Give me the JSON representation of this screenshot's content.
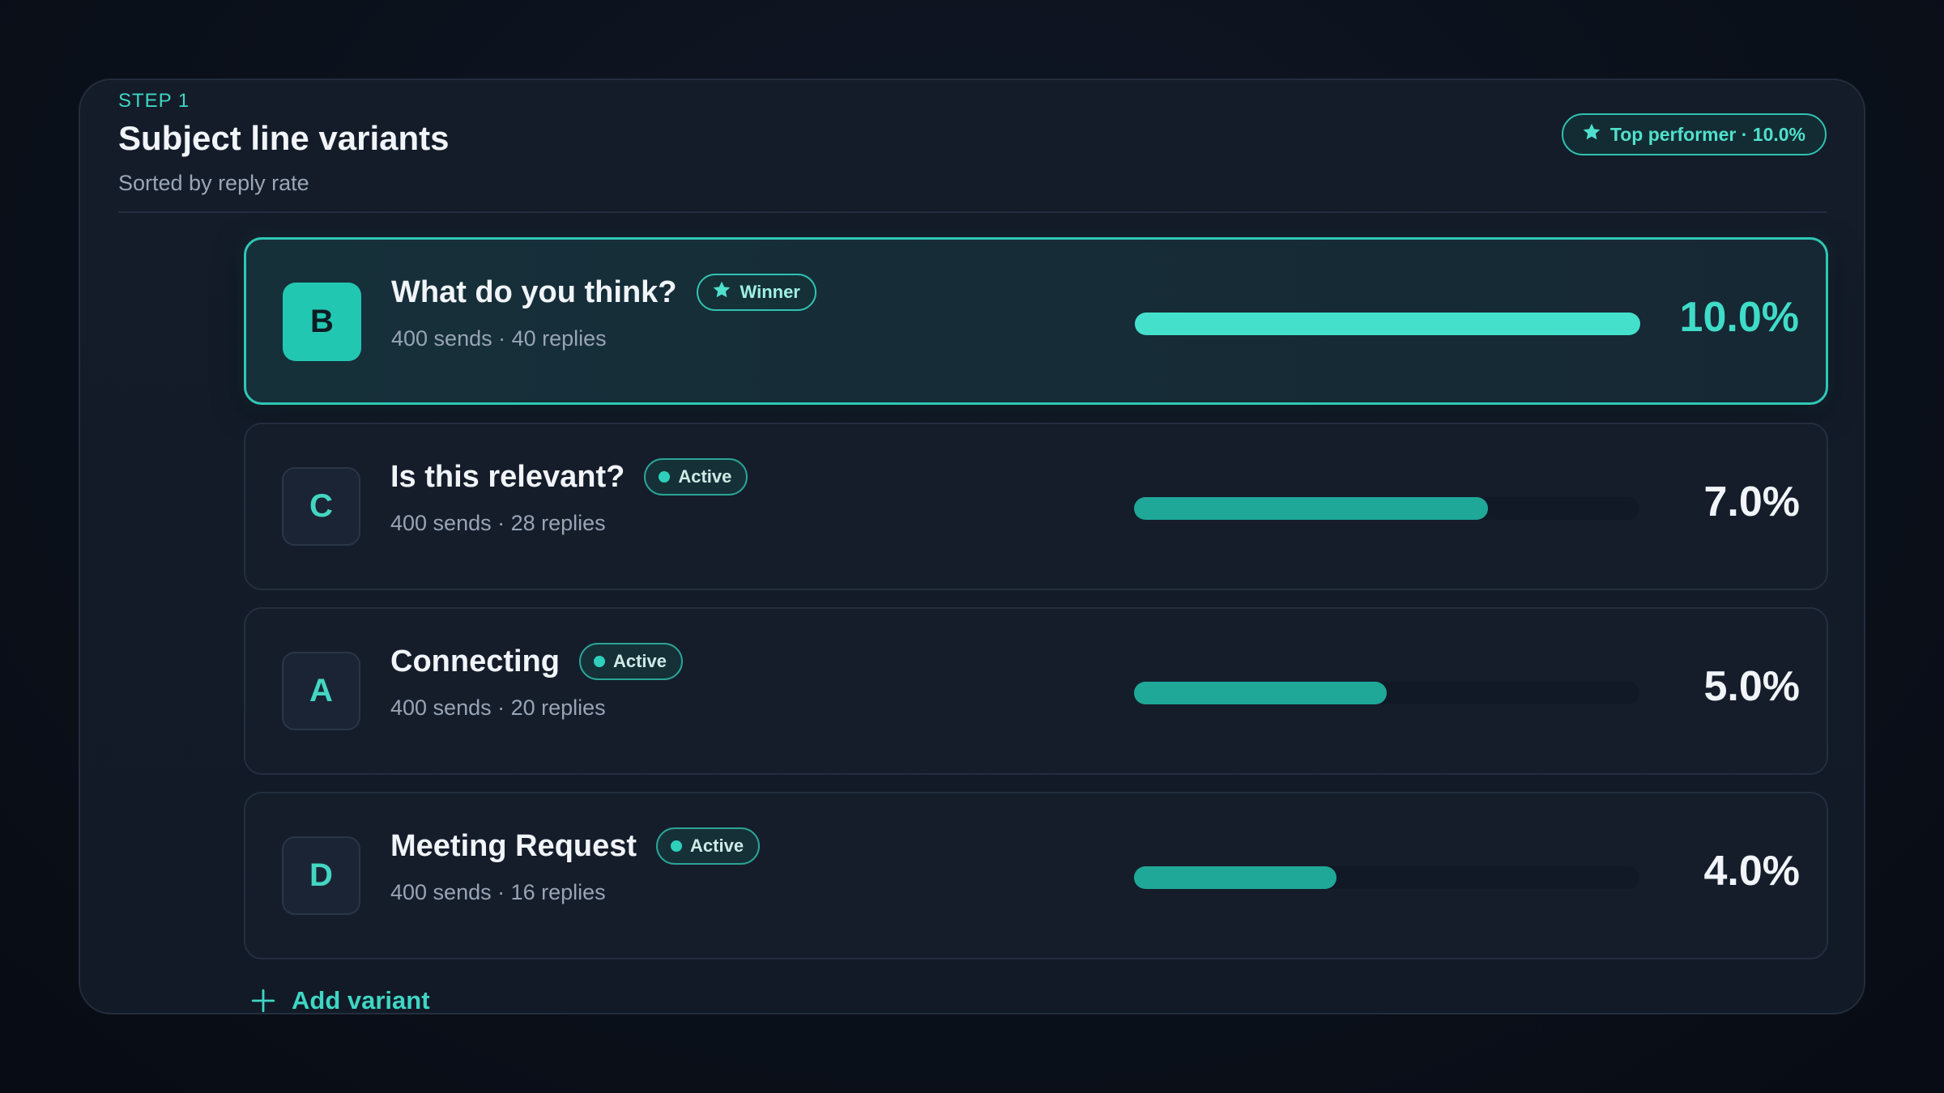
{
  "header": {
    "step_label": "STEP 1",
    "title": "Subject line variants",
    "subtitle": "Sorted by reply rate",
    "top_badge": {
      "icon": "star-icon",
      "label": "Top performer · 10.0%"
    }
  },
  "variants": [
    {
      "letter": "B",
      "subject": "What do you think?",
      "status": "Winner",
      "status_icon": "star-icon",
      "stats": "400 sends · 40 replies",
      "rate_label": "10.0%",
      "rate": 10.0
    },
    {
      "letter": "C",
      "subject": "Is this relevant?",
      "status": "Active",
      "status_icon": "dot-icon",
      "stats": "400 sends · 28 replies",
      "rate_label": "7.0%",
      "rate": 7.0
    },
    {
      "letter": "A",
      "subject": "Connecting",
      "status": "Active",
      "status_icon": "dot-icon",
      "stats": "400 sends · 20 replies",
      "rate_label": "5.0%",
      "rate": 5.0
    },
    {
      "letter": "D",
      "subject": "Meeting Request",
      "status": "Active",
      "status_icon": "dot-icon",
      "stats": "400 sends · 16 replies",
      "rate_label": "4.0%",
      "rate": 4.0
    }
  ],
  "bar_scale_max": 10.0,
  "footer": {
    "add_variant_label": "Add variant",
    "add_icon": "plus-icon"
  },
  "colors": {
    "accent": "#3fd6c3",
    "winner_bar": "#45e0cc",
    "active_bar": "#1fa898",
    "background": "#0b111b"
  }
}
